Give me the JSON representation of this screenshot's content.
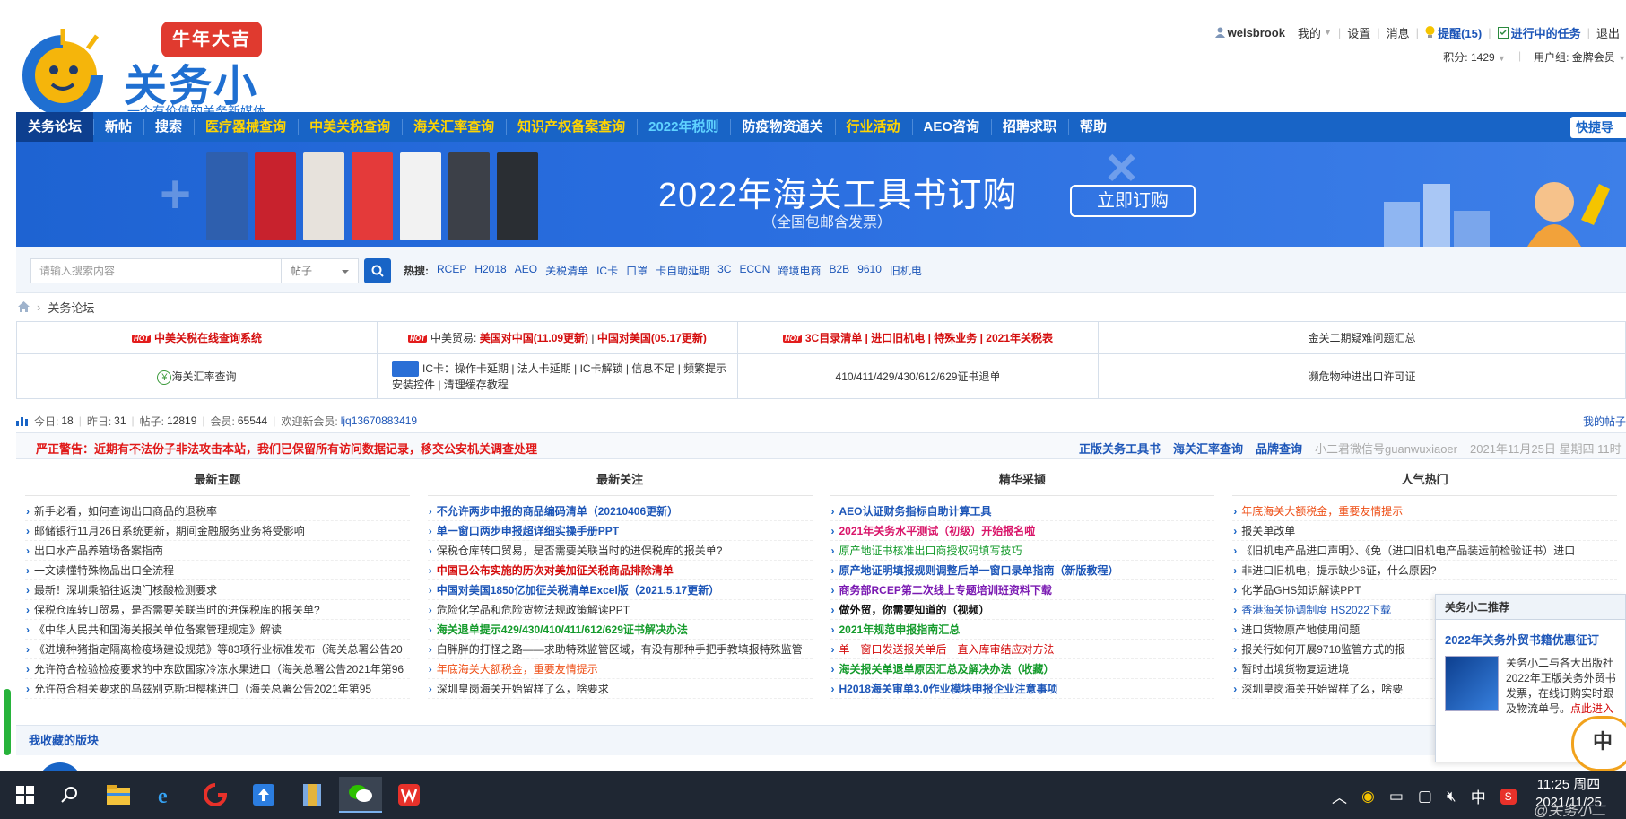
{
  "logo": {
    "badge": "牛年大吉",
    "title": "关务小二",
    "slogan": "一个有价值的关务新媒体"
  },
  "user_bar": {
    "username": "weisbrook",
    "mine": "我的",
    "settings": "设置",
    "messages": "消息",
    "reminders": "提醒(15)",
    "tasks": "进行中的任务",
    "logout": "退出"
  },
  "points_bar": {
    "points": "积分: 1429",
    "group": "用户组: 金牌会员"
  },
  "nav": {
    "items": [
      {
        "label": "关务论坛"
      },
      {
        "label": "新帖"
      },
      {
        "label": "搜索"
      },
      {
        "label": "医疗器械查询"
      },
      {
        "label": "中美关税查询"
      },
      {
        "label": "海关汇率查询"
      },
      {
        "label": "知识产权备案查询"
      },
      {
        "label": "2022年税则"
      },
      {
        "label": "防疫物资通关"
      },
      {
        "label": "行业活动"
      },
      {
        "label": "AEO咨询"
      },
      {
        "label": "招聘求职"
      },
      {
        "label": "帮助"
      }
    ],
    "quick": "快捷导"
  },
  "banner": {
    "title": "2022年海关工具书订购",
    "subtitle": "（全国包邮含发票）",
    "button": "立即订购"
  },
  "search": {
    "placeholder": "请输入搜索内容",
    "type": "帖子",
    "hot_label": "热搜:",
    "keywords": [
      "RCEP",
      "H2018",
      "AEO",
      "关税清单",
      "IC卡",
      "口罩",
      "卡自助延期",
      "3C",
      "ECCN",
      "跨境电商",
      "B2B",
      "9610",
      "旧机电"
    ]
  },
  "breadcrumb": {
    "current": "关务论坛"
  },
  "link_table": {
    "r1c1": "中美关税在线查询系统",
    "r1c2_prefix": "中美贸易:",
    "r1c2_a": "美国对中国(11.09更新)",
    "r1c2_sep": " | ",
    "r1c2_b": "中国对美国(05.17更新)",
    "r1c3": "3C目录清单 | 进口旧机电 | 特殊业务 | 2021年关税表",
    "r1c4": "金关二期疑难问题汇总",
    "r2c1": "海关汇率查询",
    "r2c2": "IC卡：操作卡延期 | 法人卡延期 | IC卡解锁 | 信息不足 | 频繁提示安装控件 | 清理缓存教程",
    "r2c3": "410/411/429/430/612/629证书退单",
    "r2c4": "濒危物种进出口许可证",
    "hot_tag": "HOT"
  },
  "stats": {
    "today_label": "今日:",
    "today": "18",
    "yesterday_label": "昨日:",
    "yesterday": "31",
    "posts_label": "帖子:",
    "posts": "12819",
    "members_label": "会员:",
    "members": "65544",
    "welcome_label": "欢迎新会员:",
    "newest": "ljq13670883419",
    "my_posts": "我的帖子"
  },
  "warning": {
    "text": "严正警告：近期有不法份子非法攻击本站，我们已保留所有访问数据记录，移交公安机关调查处理",
    "links": [
      "正版关务工具书",
      "海关汇率查询",
      "品牌查询"
    ],
    "wechat": "小二君微信号guanwuxiaoer",
    "date": "2021年11月25日 星期四 11时"
  },
  "columns": [
    {
      "title": "最新主题",
      "items": [
        {
          "text": "新手必看，如何查询出口商品的退税率",
          "style": ""
        },
        {
          "text": "邮储银行11月26日系统更新，期间金融服务业务将受影响",
          "style": ""
        },
        {
          "text": "出口水产品养殖场备案指南",
          "style": ""
        },
        {
          "text": "一文读懂特殊物品出口全流程",
          "style": ""
        },
        {
          "text": "最新！深圳乘船往返澳门核酸检测要求",
          "style": ""
        },
        {
          "text": "保税仓库转口贸易，是否需要关联当时的进保税库的报关单?",
          "style": ""
        },
        {
          "text": "《中华人民共和国海关报关单位备案管理规定》解读",
          "style": ""
        },
        {
          "text": "《进境种猪指定隔离检疫场建设规范》等83项行业标准发布（海关总署公告20",
          "style": ""
        },
        {
          "text": "允许符合检验检疫要求的中东欧国家冷冻水果进口（海关总署公告2021年第96",
          "style": ""
        },
        {
          "text": "允许符合相关要求的乌兹别克斯坦樱桃进口（海关总署公告2021年第95",
          "style": ""
        }
      ]
    },
    {
      "title": "最新关注",
      "items": [
        {
          "text": "不允许两步申报的商品编码清单（20210406更新）",
          "style": "c-blue"
        },
        {
          "text": "单一窗口两步申报超详细实操手册PPT",
          "style": "c-blue"
        },
        {
          "text": "保税仓库转口贸易，是否需要关联当时的进保税库的报关单?",
          "style": ""
        },
        {
          "text": "中国已公布实施的历次对美加征关税商品排除清单",
          "style": "c-red"
        },
        {
          "text": "中国对美国1850亿加征关税清单Excel版（2021.5.17更新）",
          "style": "c-blue"
        },
        {
          "text": "危险化学品和危险货物法规政策解读PPT",
          "style": ""
        },
        {
          "text": "海关退单提示429/430/410/411/612/629证书解决办法",
          "style": "c-green"
        },
        {
          "text": "白胖胖的打怪之路——求助特殊监管区域，有没有那种手把手教填报特殊监管",
          "style": ""
        },
        {
          "text": "年底海关大额税金，重要友情提示",
          "style": "c-orange"
        },
        {
          "text": "深圳皇岗海关开始留样了么，啥要求",
          "style": ""
        }
      ]
    },
    {
      "title": "精华采撷",
      "items": [
        {
          "text": "AEO认证财务指标自助计算工具",
          "style": "c-blue"
        },
        {
          "text": "2021年关务水平测试（初级）开始报名啦",
          "style": "c-pink"
        },
        {
          "text": "原产地证书核准出口商授权码填写技巧",
          "style": "c-lgreen"
        },
        {
          "text": "原产地证明填报规则调整后单一窗口录单指南（新版教程）",
          "style": "c-blue"
        },
        {
          "text": "商务部RCEP第二次线上专题培训班资料下载",
          "style": "c-purple"
        },
        {
          "text": "做外贸，你需要知道的（视频）",
          "style": "c-black"
        },
        {
          "text": "2021年规范申报指南汇总",
          "style": "c-green"
        },
        {
          "text": "单一窗口发送报关单后一直入库审结应对方法",
          "style": "c-lred"
        },
        {
          "text": "海关报关单退单原因汇总及解决办法（收藏）",
          "style": "c-green"
        },
        {
          "text": "H2018海关审单3.0作业模块申报企业注意事项",
          "style": "c-blue"
        }
      ]
    },
    {
      "title": "人气热门",
      "items": [
        {
          "text": "年底海关大额税金，重要友情提示",
          "style": "c-orange"
        },
        {
          "text": "报关单改单",
          "style": ""
        },
        {
          "text": "《旧机电产品进口声明》、《免（进口旧机电产品装运前检验证书）进口",
          "style": ""
        },
        {
          "text": "非进口旧机电，提示缺少6证，什么原因?",
          "style": ""
        },
        {
          "text": "化学品GHS知识解读PPT",
          "style": ""
        },
        {
          "text": "香港海关协调制度 HS2022下载",
          "style": "c-lblue"
        },
        {
          "text": "进口货物原产地使用问题",
          "style": ""
        },
        {
          "text": "报关行如何开展9710监管方式的报",
          "style": ""
        },
        {
          "text": "暂时出境货物复运进境",
          "style": ""
        },
        {
          "text": "深圳皇岗海关开始留样了么，啥要",
          "style": ""
        }
      ]
    }
  ],
  "favorites": {
    "title": "我收藏的版块"
  },
  "recommend": {
    "head": "关务小二推荐",
    "title": "2022年关务外贸书籍优惠征订",
    "body": "关务小二与各大出版社2022年正版关务外贸书发票，在线订购实时跟及物流单号。",
    "link": "点此进入"
  },
  "mascot": {
    "text": "中"
  },
  "taskbar": {
    "ime": "中",
    "time": "11:25 周四",
    "date": "2021/11/25"
  },
  "watermark": "@关务小二",
  "colors": {
    "nav": "#1864c6",
    "nav_active": "#0d3f8f",
    "nav_highlight": "#ffd400",
    "link_blue": "#1d56b8",
    "alert_red": "#d40d0d",
    "taskbar": "#1f2733"
  }
}
